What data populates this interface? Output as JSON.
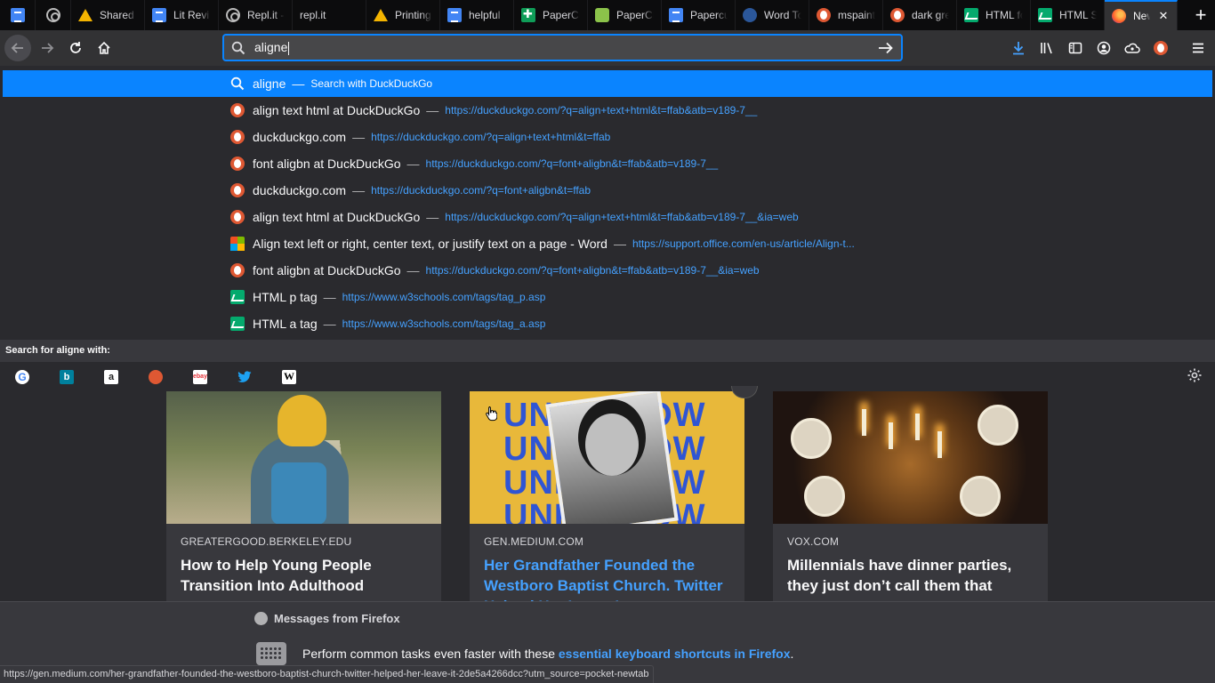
{
  "tabs": [
    {
      "label": "",
      "icon": "google-docs-icon"
    },
    {
      "label": "",
      "icon": "replit-icon"
    },
    {
      "label": "Shared",
      "icon": "google-drive-icon"
    },
    {
      "label": "Lit Revi",
      "icon": "google-docs-icon"
    },
    {
      "label": "Repl.it -",
      "icon": "replit-icon"
    },
    {
      "label": "repl.it",
      "icon": "none"
    },
    {
      "label": "Printing",
      "icon": "google-drive-icon"
    },
    {
      "label": "helpful",
      "icon": "google-docs-icon"
    },
    {
      "label": "PaperCu",
      "icon": "green-plus-icon"
    },
    {
      "label": "PaperCu",
      "icon": "lime-icon"
    },
    {
      "label": "Papercu",
      "icon": "google-docs-icon"
    },
    {
      "label": "Word To",
      "icon": "gear-addin-icon"
    },
    {
      "label": "mspaint",
      "icon": "duckduckgo-icon"
    },
    {
      "label": "dark gre",
      "icon": "duckduckgo-icon"
    },
    {
      "label": "HTML fo",
      "icon": "w3schools-icon"
    },
    {
      "label": "HTML S",
      "icon": "w3schools-icon"
    }
  ],
  "active_tab": {
    "label": "New",
    "icon": "firefox-icon",
    "close": "✕"
  },
  "new_tab_symbol": "+",
  "urlbar": {
    "value": "aligne"
  },
  "results": [
    {
      "title": "aligne",
      "sep": "—",
      "url": "Search with DuckDuckGo",
      "icon": "search-icon",
      "selected": true
    },
    {
      "title": "align text html at DuckDuckGo",
      "sep": "—",
      "url": "https://duckduckgo.com/?q=align+text+html&t=ffab&atb=v189-7__",
      "icon": "duckduckgo-icon"
    },
    {
      "title": "duckduckgo.com",
      "sep": "—",
      "url": "https://duckduckgo.com/?q=align+text+html&t=ffab",
      "icon": "duckduckgo-icon"
    },
    {
      "title": "font aligbn at DuckDuckGo",
      "sep": "—",
      "url": "https://duckduckgo.com/?q=font+aligbn&t=ffab&atb=v189-7__",
      "icon": "duckduckgo-icon"
    },
    {
      "title": "duckduckgo.com",
      "sep": "—",
      "url": "https://duckduckgo.com/?q=font+aligbn&t=ffab",
      "icon": "duckduckgo-icon"
    },
    {
      "title": "align text html at DuckDuckGo",
      "sep": "—",
      "url": "https://duckduckgo.com/?q=align+text+html&t=ffab&atb=v189-7__&ia=web",
      "icon": "duckduckgo-icon"
    },
    {
      "title": "Align text left or right, center text, or justify text on a page - Word",
      "sep": "—",
      "url": "https://support.office.com/en-us/article/Align-t...",
      "icon": "microsoft-icon"
    },
    {
      "title": "font aligbn at DuckDuckGo",
      "sep": "—",
      "url": "https://duckduckgo.com/?q=font+aligbn&t=ffab&atb=v189-7__&ia=web",
      "icon": "duckduckgo-icon"
    },
    {
      "title": "HTML p tag",
      "sep": "—",
      "url": "https://www.w3schools.com/tags/tag_p.asp",
      "icon": "w3schools-icon"
    },
    {
      "title": "HTML a tag",
      "sep": "—",
      "url": "https://www.w3schools.com/tags/tag_a.asp",
      "icon": "w3schools-icon"
    }
  ],
  "search_with_label": "Search for aligne with:",
  "engines": [
    {
      "name": "google",
      "glyph": "G"
    },
    {
      "name": "bing",
      "glyph": "b"
    },
    {
      "name": "amazon",
      "glyph": "a"
    },
    {
      "name": "duckduckgo",
      "glyph": ""
    },
    {
      "name": "ebay",
      "glyph": "ebay"
    },
    {
      "name": "twitter",
      "glyph": "🐦"
    },
    {
      "name": "wikipedia",
      "glyph": "W"
    }
  ],
  "cards": [
    {
      "source": "GREATERGOOD.BERKELEY.EDU",
      "title": "How to Help Young People Transition Into Adulthood"
    },
    {
      "source": "GEN.MEDIUM.COM",
      "title": "Her Grandfather Founded the Westboro Baptist Church. Twitter Helped Her Leave It",
      "image_text": "UNFOLLOW"
    },
    {
      "source": "VOX.COM",
      "title": "Millennials have dinner parties, they just don’t call them that"
    }
  ],
  "messages": {
    "header": "Messages from Firefox",
    "body_prefix": "Perform common tasks even faster with these",
    "link": "essential keyboard shortcuts in Firefox",
    "body_suffix": "."
  },
  "status_url": "https://gen.medium.com/her-grandfather-founded-the-westboro-baptist-church-twitter-helped-her-leave-it-2de5a4266dcc?utm_source=pocket-newtab",
  "colors": {
    "accent": "#0a84ff",
    "link": "#45a1ff",
    "background": "#2a2a2e",
    "tabstrip": "#0c0c0d"
  }
}
